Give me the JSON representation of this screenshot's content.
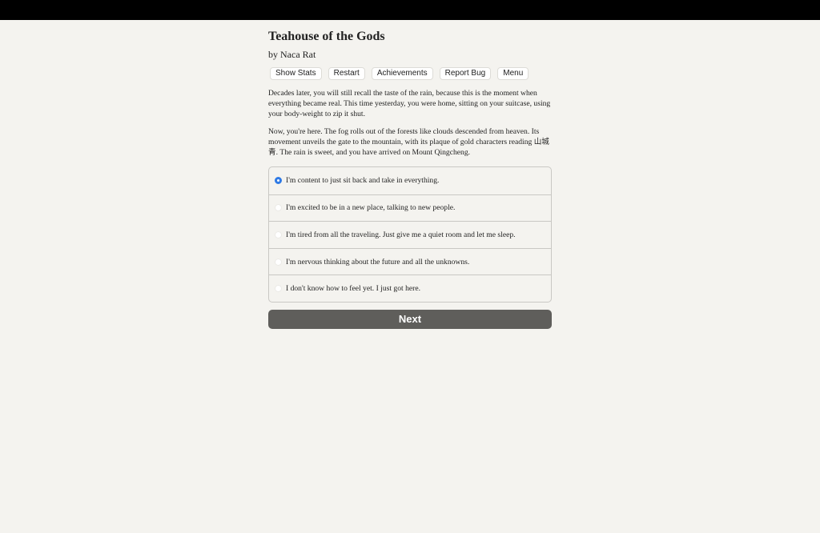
{
  "game": {
    "title": "Teahouse of the Gods",
    "author": "by Naca Rat"
  },
  "toolbar": {
    "show_stats": "Show Stats",
    "restart": "Restart",
    "achievements": "Achievements",
    "report_bug": "Report Bug",
    "menu": "Menu"
  },
  "passage": {
    "paragraphs": [
      "Decades later, you will still recall the taste of the rain, because this is the moment when everything became real. This time yesterday, you were home, sitting on your suitcase, using your body-weight to zip it shut.",
      "Now, you're here. The fog rolls out of the forests like clouds descended from heaven. Its movement unveils the gate to the mountain, with its plaque of gold characters reading 山城青. The rain is sweet, and you have arrived on Mount Qingcheng."
    ]
  },
  "choices": {
    "selected_index": 0,
    "options": [
      {
        "label": "I'm content to just sit back and take in everything.",
        "checked": true
      },
      {
        "label": "I'm excited to be in a new place, talking to new people.",
        "checked": false
      },
      {
        "label": "I'm tired from all the traveling. Just give me a quiet room and let me sleep.",
        "checked": false
      },
      {
        "label": "I'm nervous thinking about the future and all the unknowns.",
        "checked": false
      },
      {
        "label": "I don't know how to feel yet. I just got here.",
        "checked": false
      }
    ]
  },
  "next_button": {
    "label": "Next"
  },
  "colors": {
    "background": "#f4f3ef",
    "accent_radio": "#2f7ae5",
    "next_button": "#5f5e5b",
    "topbar": "#000000"
  }
}
